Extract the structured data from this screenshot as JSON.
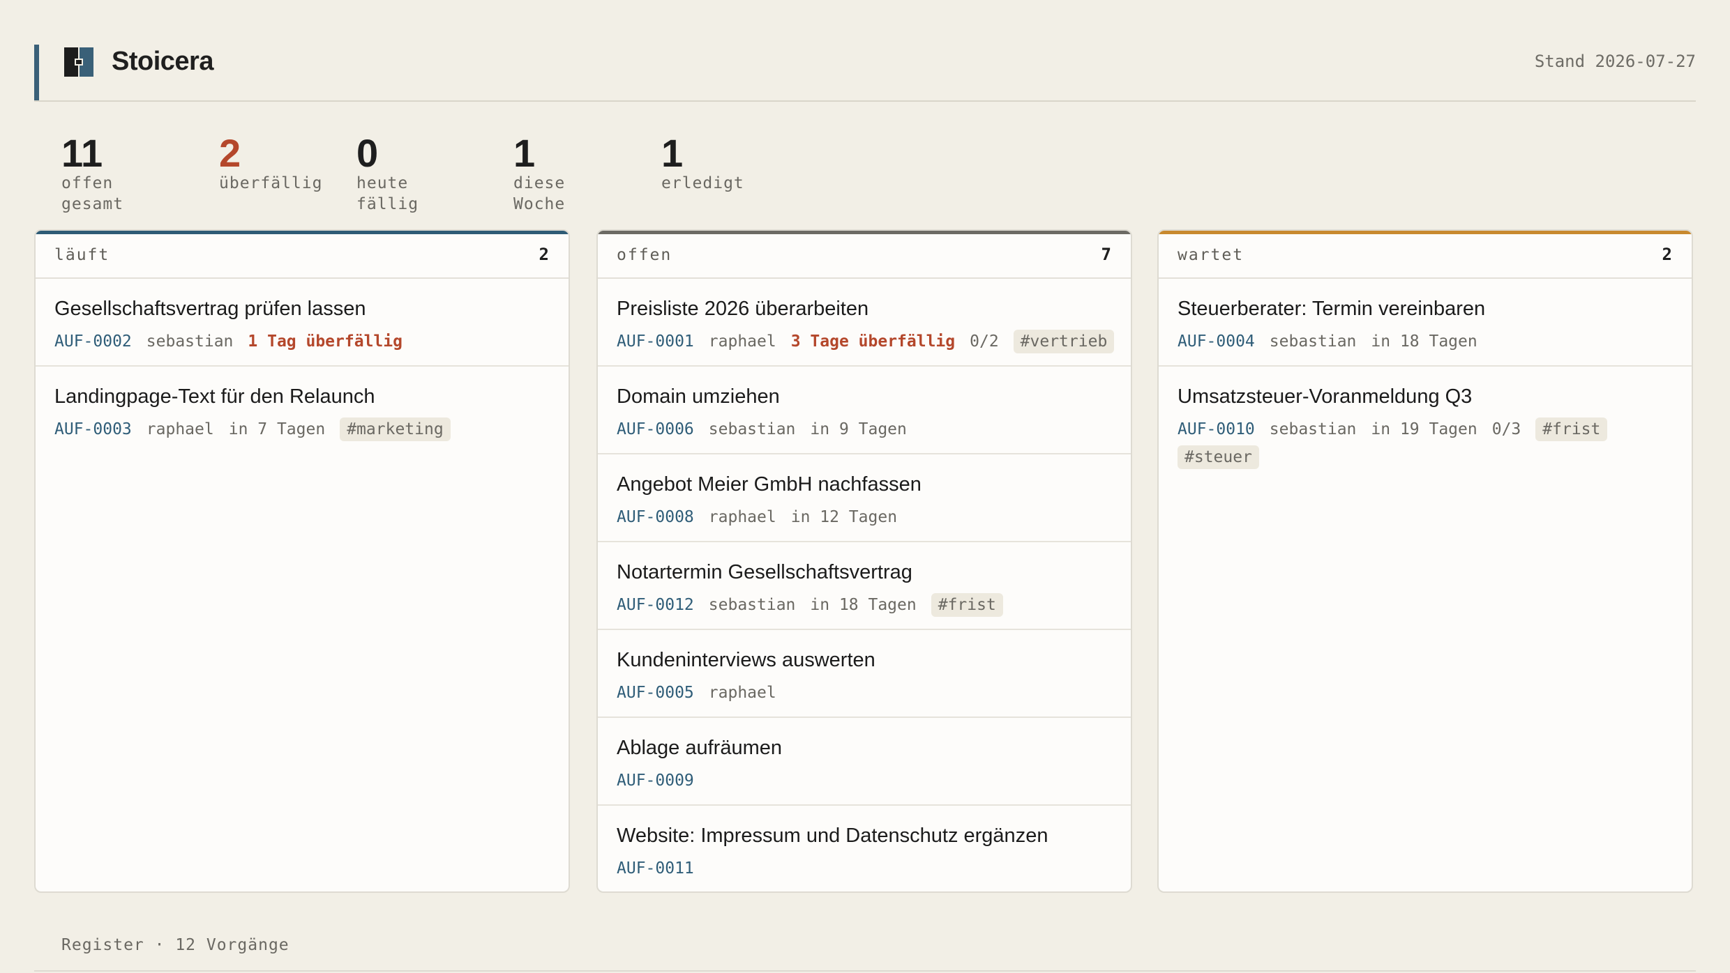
{
  "app": {
    "title": "Stoicera",
    "stand": "Stand 2026-07-27",
    "accent": "#3a6078"
  },
  "stats": [
    {
      "value": "11",
      "label": "offen gesamt"
    },
    {
      "value": "2",
      "label": "überfällig",
      "color": "#b4472b"
    },
    {
      "value": "0",
      "label": "heute fällig"
    },
    {
      "value": "1",
      "label": "diese Woche"
    },
    {
      "value": "1",
      "label": "erledigt"
    }
  ],
  "columns": [
    {
      "name": "läuft",
      "count": "2",
      "color": "#2e5b75",
      "cards": [
        {
          "title": "Gesellschaftsvertrag prüfen lassen",
          "id": "AUF-0002",
          "user": "sebastian",
          "overdue": "1 Tag überfällig"
        },
        {
          "title": "Landingpage-Text für den Relaunch",
          "id": "AUF-0003",
          "user": "raphael",
          "due": "in 7 Tagen",
          "tags": [
            "#marketing"
          ]
        }
      ]
    },
    {
      "name": "offen",
      "count": "7",
      "color": "#6c6a64",
      "cards": [
        {
          "title": "Preisliste 2026 überarbeiten",
          "id": "AUF-0001",
          "user": "raphael",
          "overdue": "3 Tage überfällig",
          "progress": "0/2",
          "tags": [
            "#vertrieb"
          ]
        },
        {
          "title": "Domain umziehen",
          "id": "AUF-0006",
          "user": "sebastian",
          "due": "in 9 Tagen"
        },
        {
          "title": "Angebot Meier GmbH nachfassen",
          "id": "AUF-0008",
          "user": "raphael",
          "due": "in 12 Tagen"
        },
        {
          "title": "Notartermin Gesellschaftsvertrag",
          "id": "AUF-0012",
          "user": "sebastian",
          "due": "in 18 Tagen",
          "tags": [
            "#frist"
          ]
        },
        {
          "title": "Kundeninterviews auswerten",
          "id": "AUF-0005",
          "user": "raphael"
        },
        {
          "title": "Ablage aufräumen",
          "id": "AUF-0009"
        },
        {
          "title": "Website: Impressum und Datenschutz ergänzen",
          "id": "AUF-0011"
        }
      ]
    },
    {
      "name": "wartet",
      "count": "2",
      "color": "#c8892e",
      "cards": [
        {
          "title": "Steuerberater: Termin vereinbaren",
          "id": "AUF-0004",
          "user": "sebastian",
          "due": "in 18 Tagen"
        },
        {
          "title": "Umsatzsteuer-Voranmeldung Q3",
          "id": "AUF-0010",
          "user": "sebastian",
          "due": "in 19 Tagen",
          "progress": "0/3",
          "tags": [
            "#frist",
            "#steuer"
          ]
        }
      ]
    }
  ],
  "footer": {
    "register": "Register · 12 Vorgänge"
  }
}
